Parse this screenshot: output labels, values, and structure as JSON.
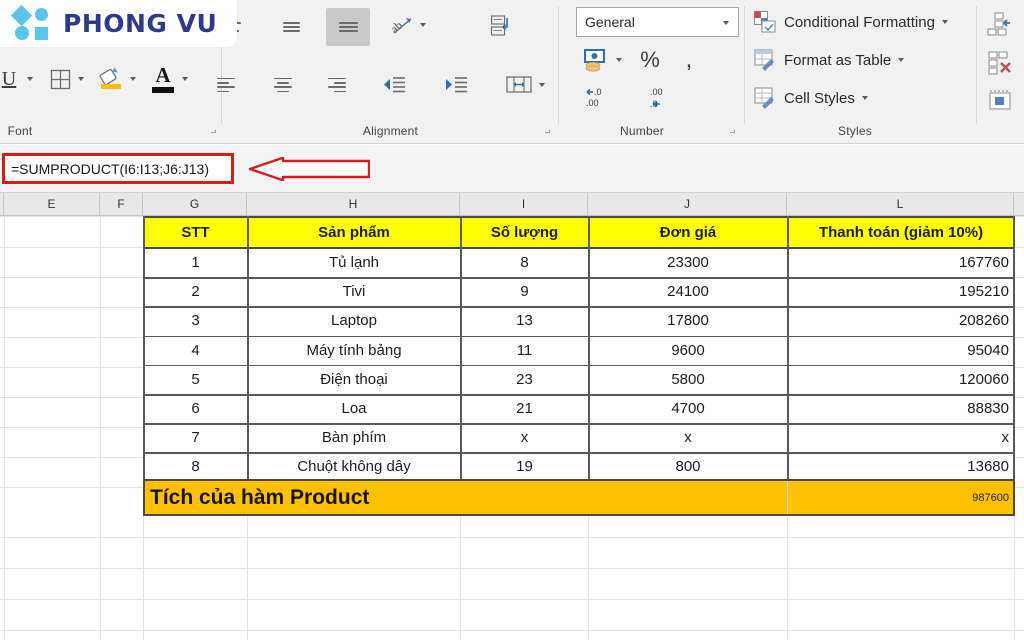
{
  "logo": {
    "text": "PHONG VU"
  },
  "ribbon": {
    "groups": [
      {
        "caption": "Font"
      },
      {
        "caption": "Alignment"
      },
      {
        "caption": "Number"
      },
      {
        "caption": "Styles"
      }
    ],
    "font": {
      "underline_label": "U",
      "font_color_label": "A"
    },
    "number": {
      "format_value": "General",
      "percent_label": "%",
      "comma_label": ",",
      "decrease_decimal_label": "←.0 .00",
      "increase_decimal_label": ".00 →.0"
    },
    "styles": {
      "conditional_formatting": "Conditional Formatting",
      "format_as_table": "Format as Table",
      "cell_styles": "Cell Styles"
    }
  },
  "formula_bar": {
    "value": "=SUMPRODUCT(I6:I13;J6:J13)",
    "highlight_color": "#d41d1d"
  },
  "sheet": {
    "column_headers": [
      "E",
      "F",
      "G",
      "H",
      "I",
      "J",
      "L"
    ],
    "table": {
      "header_bg": "#ffff00",
      "summary_bg": "#ffc000",
      "headers": [
        "STT",
        "Sản phẩm",
        "Số lượng",
        "Đơn giá",
        "Thanh toán (giảm 10%)"
      ],
      "rows": [
        {
          "stt": "1",
          "product": "Tủ lạnh",
          "qty": "8",
          "price": "23300",
          "payment": "167760"
        },
        {
          "stt": "2",
          "product": "Tivi",
          "qty": "9",
          "price": "24100",
          "payment": "195210"
        },
        {
          "stt": "3",
          "product": "Laptop",
          "qty": "13",
          "price": "17800",
          "payment": "208260"
        },
        {
          "stt": "4",
          "product": "Máy tính bảng",
          "qty": "11",
          "price": "9600",
          "payment": "95040"
        },
        {
          "stt": "5",
          "product": "Điện thoại",
          "qty": "23",
          "price": "5800",
          "payment": "120060"
        },
        {
          "stt": "6",
          "product": "Loa",
          "qty": "21",
          "price": "4700",
          "payment": "88830"
        },
        {
          "stt": "7",
          "product": "Bàn phím",
          "qty": "x",
          "price": "x",
          "payment": "x"
        },
        {
          "stt": "8",
          "product": "Chuột không dây",
          "qty": "19",
          "price": "800",
          "payment": "13680"
        }
      ],
      "summary": {
        "label": "Tích của hàm Product",
        "value": "987600"
      }
    }
  }
}
